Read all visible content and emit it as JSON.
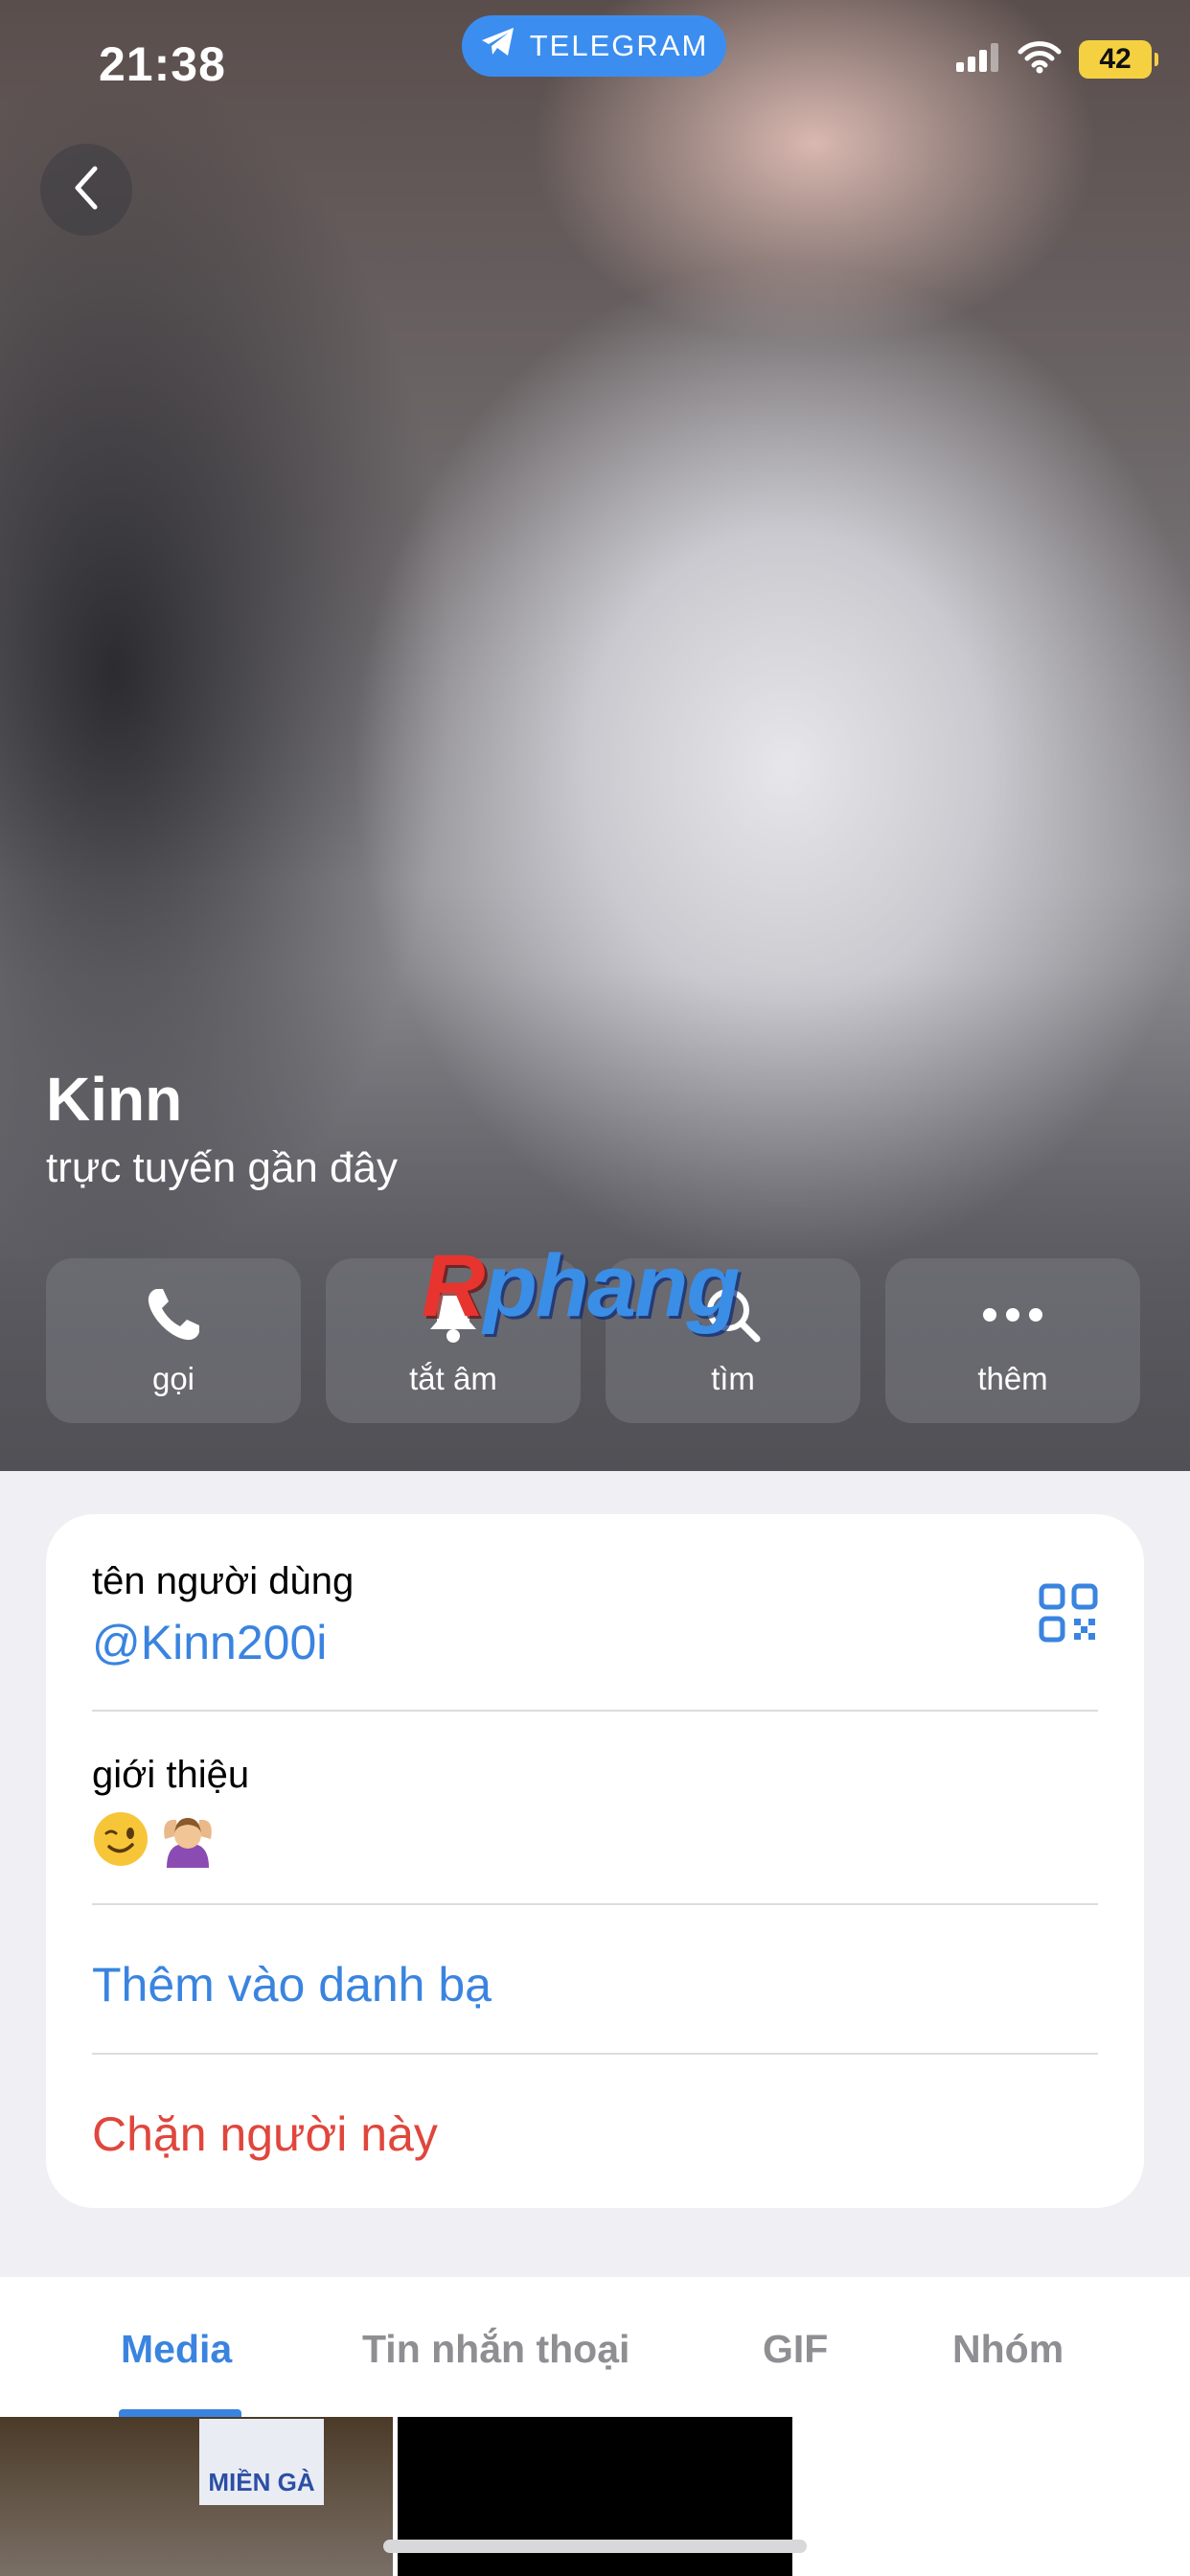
{
  "status_bar": {
    "time": "21:38",
    "app_pill": "TELEGRAM",
    "battery": "42"
  },
  "profile": {
    "name": "Kinn",
    "status": "trực tuyến gần đây"
  },
  "actions": [
    {
      "label": "gọi",
      "icon": "phone-icon"
    },
    {
      "label": "tắt âm",
      "icon": "bell-icon"
    },
    {
      "label": "tìm",
      "icon": "search-icon"
    },
    {
      "label": "thêm",
      "icon": "more-icon"
    }
  ],
  "watermark": {
    "first": "R",
    "rest": "phang"
  },
  "info": {
    "username_label": "tên người dùng",
    "username": "@Kinn200i",
    "bio_label": "giới thiệu",
    "add_contact": "Thêm vào danh bạ",
    "block": "Chặn người này"
  },
  "tabs": [
    {
      "label": "Media",
      "active": true
    },
    {
      "label": "Tin nhắn thoại",
      "active": false
    },
    {
      "label": "GIF",
      "active": false
    },
    {
      "label": "Nhóm",
      "active": false
    }
  ],
  "media": {
    "sign_text": "MIỀN GÀ"
  },
  "colors": {
    "accent": "#3a84e0",
    "danger": "#e0463c",
    "telegram": "#3b8ef0",
    "battery": "#f5d142"
  }
}
